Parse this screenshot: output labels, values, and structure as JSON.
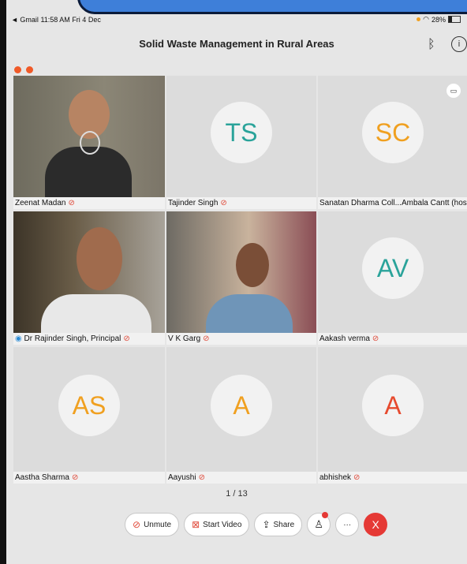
{
  "status": {
    "app": "◄ Gmail",
    "time": "11:58 AM",
    "date": "Fri 4 Dec",
    "battery": "28%"
  },
  "meeting": {
    "title": "Solid Waste Management in Rural Areas"
  },
  "participants": [
    {
      "name": "Zeenat Madan",
      "type": "video",
      "initials": "",
      "active": true
    },
    {
      "name": "Tajinder Singh",
      "type": "avatar",
      "initials": "TS",
      "initials_color": "#2aa39a"
    },
    {
      "name": "Sanatan Dharma Coll...Ambala Cantt (host)",
      "type": "avatar",
      "initials": "SC",
      "initials_color": "#f0a020"
    },
    {
      "name": "Dr Rajinder Singh, Principal",
      "type": "video",
      "initials": ""
    },
    {
      "name": "V K Garg",
      "type": "video",
      "initials": ""
    },
    {
      "name": "Aakash verma",
      "type": "avatar",
      "initials": "AV",
      "initials_color": "#2aa39a"
    },
    {
      "name": "Aastha Sharma",
      "type": "avatar",
      "initials": "AS",
      "initials_color": "#f0a020"
    },
    {
      "name": "Aayushi",
      "type": "avatar",
      "initials": "A",
      "initials_color": "#f0a020"
    },
    {
      "name": "abhishek",
      "type": "avatar",
      "initials": "A",
      "initials_color": "#e64a2e"
    }
  ],
  "pagination": {
    "label": "1 / 13"
  },
  "toolbar": {
    "unmute_label": "Unmute",
    "start_video_label": "Start Video",
    "share_label": "Share",
    "more_label": "···",
    "end_label": "X"
  },
  "colors": {
    "accent_blue": "#3e7fd9",
    "active_border": "#2a8bd6",
    "mute_red": "#e04a3a",
    "end_red": "#e53935"
  }
}
